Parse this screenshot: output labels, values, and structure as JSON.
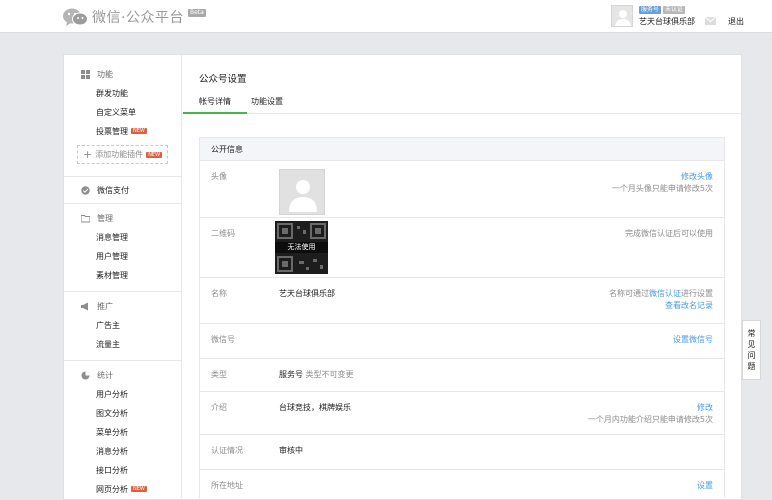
{
  "topbar": {
    "logo_text": "微信·公众平台",
    "beta": "Beta",
    "tags": [
      "服务号",
      "未认证"
    ],
    "account_name": "艺天台球俱乐部",
    "logout": "退出"
  },
  "sidebar": {
    "function": {
      "title": "功能",
      "items": [
        {
          "label": "群发功能",
          "new": ""
        },
        {
          "label": "自定义菜单",
          "new": ""
        },
        {
          "label": "投票管理",
          "new": "NEW"
        }
      ],
      "add_plugin": "添加功能插件",
      "add_plugin_new": "NEW"
    },
    "pay": {
      "title": "微信支付"
    },
    "manage": {
      "title": "管理",
      "items": [
        {
          "label": "消息管理"
        },
        {
          "label": "用户管理"
        },
        {
          "label": "素材管理"
        }
      ]
    },
    "promo": {
      "title": "推广",
      "items": [
        {
          "label": "广告主"
        },
        {
          "label": "流量主"
        }
      ]
    },
    "stats": {
      "title": "统计",
      "items": [
        {
          "label": "用户分析",
          "new": ""
        },
        {
          "label": "图文分析",
          "new": ""
        },
        {
          "label": "菜单分析",
          "new": ""
        },
        {
          "label": "消息分析",
          "new": ""
        },
        {
          "label": "接口分析",
          "new": ""
        },
        {
          "label": "网页分析",
          "new": "NEW"
        }
      ]
    }
  },
  "main": {
    "title": "公众号设置",
    "tabs": [
      {
        "label": "帐号详情",
        "active": true
      },
      {
        "label": "功能设置",
        "active": false
      }
    ],
    "section_title": "公开信息",
    "rows": {
      "avatar": {
        "label": "头像",
        "action": "修改头像",
        "hint": "一个月头像只能申请修改5次"
      },
      "qrcode": {
        "label": "二维码",
        "overlay": "无法使用",
        "hint": "完成微信认证后可以使用"
      },
      "name": {
        "label": "名称",
        "value": "艺天台球俱乐部",
        "hint_prefix": "名称可通过",
        "hint_link": "微信认证",
        "hint_suffix": "进行设置",
        "action": "查看改名记录"
      },
      "wechat_id": {
        "label": "微信号",
        "action": "设置微信号"
      },
      "type": {
        "label": "类型",
        "value": "服务号",
        "note": "类型不可变更"
      },
      "intro": {
        "label": "介绍",
        "value": "台球竞技，棋牌娱乐",
        "action": "修改",
        "hint": "一个月内功能介绍只能申请修改5次"
      },
      "verify": {
        "label": "认证情况",
        "value": "审核中"
      },
      "address": {
        "label": "所在地址",
        "action": "设置"
      }
    }
  },
  "float_help": [
    "常",
    "见",
    "问",
    "题"
  ]
}
